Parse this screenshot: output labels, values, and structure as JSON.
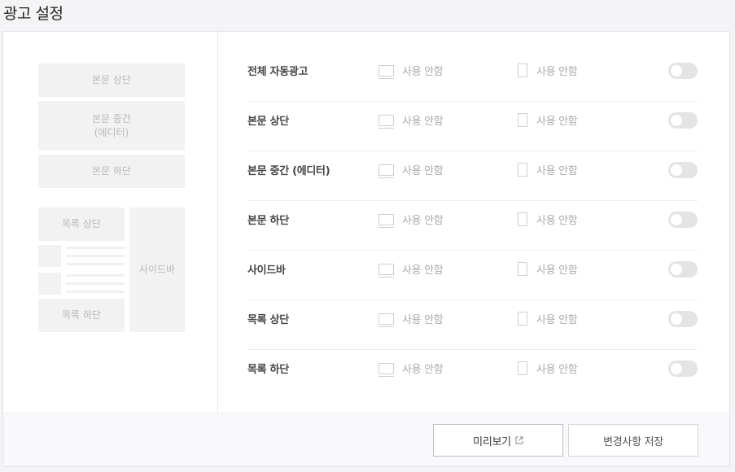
{
  "page": {
    "title": "광고 설정"
  },
  "preview": {
    "body_top": "본문 상단",
    "body_middle": "본문 중간\n(에디터)",
    "body_bottom": "본문 하단",
    "list_top": "목록 상단",
    "list_bottom": "목록 하단",
    "sidebar": "사이드바"
  },
  "settings": {
    "rows": [
      {
        "label": "전체 자동광고",
        "pc": "사용 안함",
        "mobile": "사용 안함",
        "enabled": false
      },
      {
        "label": "본문 상단",
        "pc": "사용 안함",
        "mobile": "사용 안함",
        "enabled": false
      },
      {
        "label": "본문 중간 (에디터)",
        "pc": "사용 안함",
        "mobile": "사용 안함",
        "enabled": false
      },
      {
        "label": "본문 하단",
        "pc": "사용 안함",
        "mobile": "사용 안함",
        "enabled": false
      },
      {
        "label": "사이드바",
        "pc": "사용 안함",
        "mobile": "사용 안함",
        "enabled": false
      },
      {
        "label": "목록 상단",
        "pc": "사용 안함",
        "mobile": "사용 안함",
        "enabled": false
      },
      {
        "label": "목록 하단",
        "pc": "사용 안함",
        "mobile": "사용 안함",
        "enabled": false
      }
    ]
  },
  "footer": {
    "preview_label": "미리보기",
    "save_label": "변경사항 저장"
  },
  "icons": {
    "pc": "monitor-icon",
    "mobile": "phone-icon",
    "external": "external-link-icon"
  }
}
